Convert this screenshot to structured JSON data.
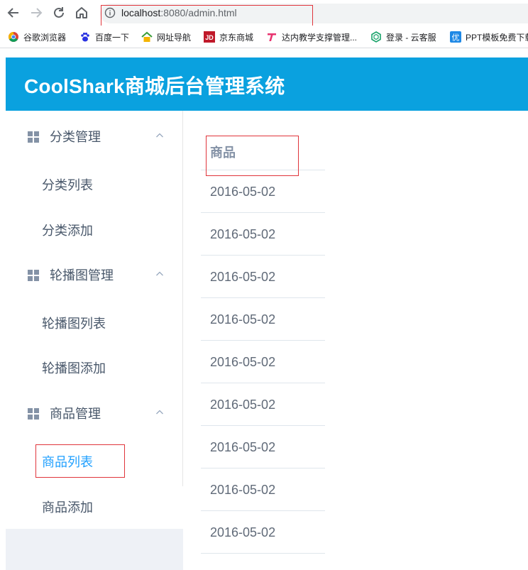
{
  "browser": {
    "url_host": "localhost",
    "url_rest": ":8080/admin.html",
    "bookmarks": [
      {
        "label": "谷歌浏览器",
        "icon": "chrome-icon"
      },
      {
        "label": "百度一下",
        "icon": "baidu-paw-icon"
      },
      {
        "label": "网址导航",
        "icon": "home-nav-icon"
      },
      {
        "label": "京东商城",
        "icon": "jd-icon"
      },
      {
        "label": "达内教学支撑管理...",
        "icon": "tarena-icon"
      },
      {
        "label": "登录 - 云客服",
        "icon": "hexagon-icon"
      },
      {
        "label": "PPT模板免费下载",
        "icon": "you-icon"
      }
    ]
  },
  "header": {
    "title": "CoolShark商城后台管理系统"
  },
  "sidebar": {
    "groups": [
      {
        "title": "分类管理",
        "items": [
          "分类列表",
          "分类添加"
        ]
      },
      {
        "title": "轮播图管理",
        "items": [
          "轮播图列表",
          "轮播图添加"
        ]
      },
      {
        "title": "商品管理",
        "items": [
          "商品列表",
          "商品添加"
        ]
      }
    ],
    "active_item": "商品列表"
  },
  "table": {
    "header": "商品",
    "rows": [
      "2016-05-02",
      "2016-05-02",
      "2016-05-02",
      "2016-05-02",
      "2016-05-02",
      "2016-05-02",
      "2016-05-02",
      "2016-05-02",
      "2016-05-02"
    ]
  },
  "colors": {
    "header_bg": "#0aa1df",
    "active_text": "#20a0ff",
    "highlight_border": "#e0353b"
  }
}
